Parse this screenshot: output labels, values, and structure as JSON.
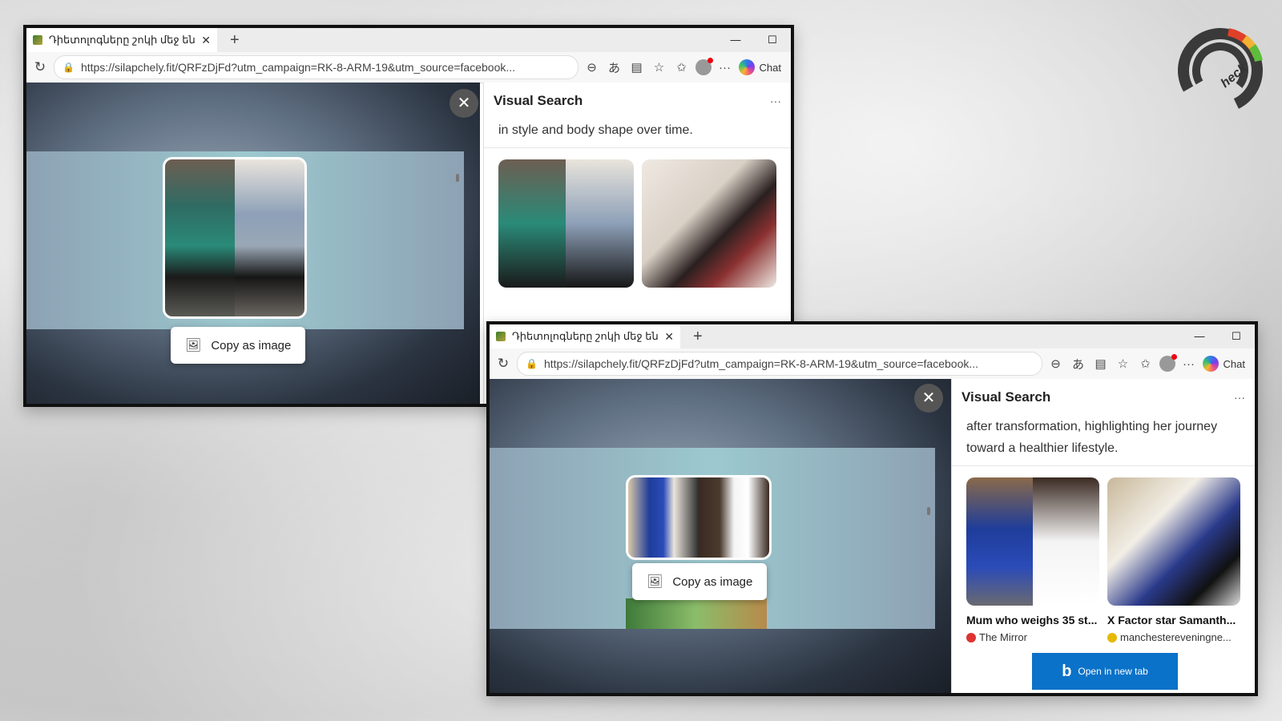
{
  "windows": [
    {
      "tab_title": "Դիետոլոգները շոկի մեջ են: Երկ",
      "url": "https://silapchely.fit/QRFzDjFd?utm_campaign=RK-8-ARM-19&utm_source=facebook...",
      "chat_label": "Chat",
      "panel_title": "Visual Search",
      "panel_desc": "in style and body shape over time.",
      "copy_label": "Copy as image"
    },
    {
      "tab_title": "Դիետոլոգները շոկի մեջ են: Երկ",
      "url": "https://silapchely.fit/QRFzDjFd?utm_campaign=RK-8-ARM-19&utm_source=facebook...",
      "chat_label": "Chat",
      "panel_title": "Visual Search",
      "panel_desc": "after transformation, highlighting her journey toward a healthier lifestyle.",
      "copy_label": "Copy as image",
      "results": [
        {
          "title": "Mum who weighs 35 st...",
          "source": "The Mirror"
        },
        {
          "title": "X Factor star Samanth...",
          "source": "manchestereveningne..."
        }
      ],
      "open_tab_label": "Open in new tab"
    }
  ],
  "icons": {
    "close": "✕",
    "newtab": "+",
    "minimize": "—",
    "maximize": "☐",
    "reload": "↻",
    "lock": "🔒",
    "zoom": "⊖",
    "translate": "あ",
    "reader": "▤",
    "favorite": "☆",
    "favorites": "✩",
    "more": "···",
    "image": "🖼"
  },
  "brand": {
    "logo_text": "heck"
  },
  "colors": {
    "accent_blue": "#0a72c8"
  }
}
